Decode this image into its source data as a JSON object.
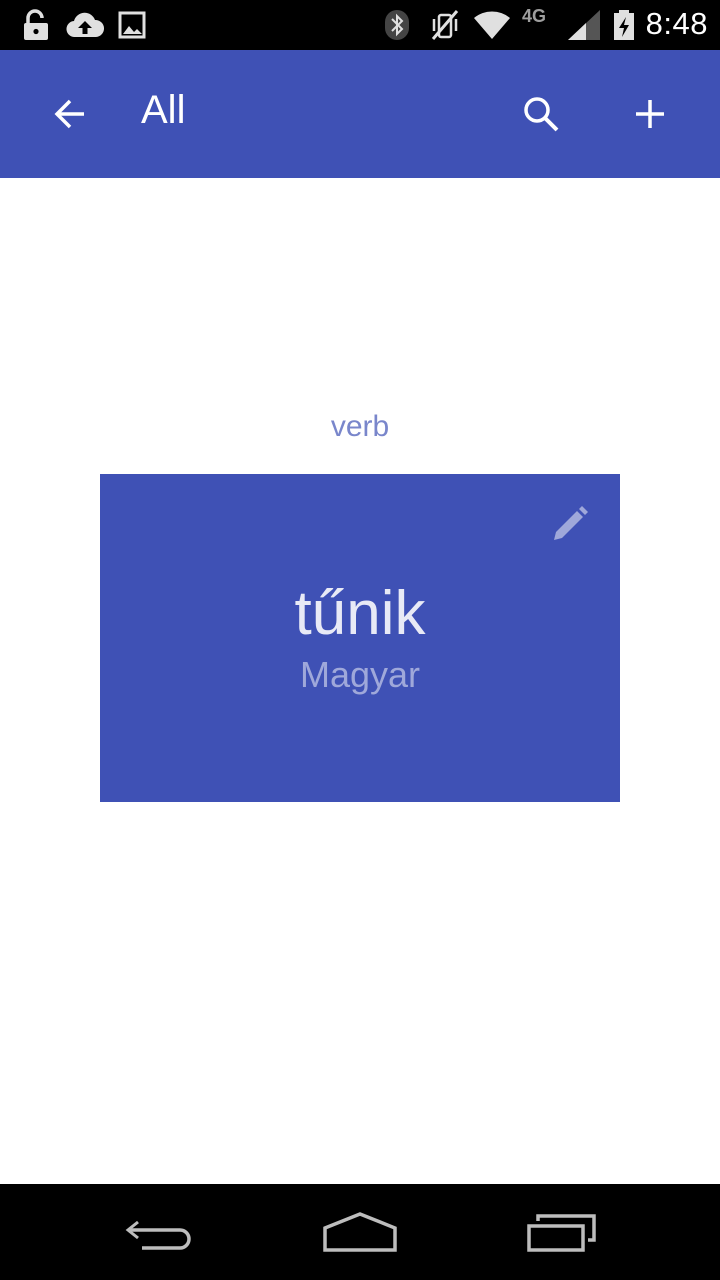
{
  "status_bar": {
    "time": "8:48",
    "network_label": "4G",
    "icons": [
      "unlock-icon",
      "cloud-upload-icon",
      "image-icon",
      "bluetooth-icon",
      "vibrate-off-icon",
      "wifi-icon",
      "cell-signal-icon",
      "battery-charging-icon"
    ]
  },
  "app_bar": {
    "title": "All",
    "back_icon": "arrow-back-icon",
    "search_icon": "search-icon",
    "add_icon": "add-icon",
    "color": "#3f51b5"
  },
  "card": {
    "part_of_speech": "verb",
    "word": "tűnik",
    "language": "Magyar",
    "edit_icon": "pencil-icon",
    "color": "#3f51b5"
  },
  "nav_bar": {
    "icons": [
      "back-nav-icon",
      "home-nav-icon",
      "recents-nav-icon"
    ]
  }
}
